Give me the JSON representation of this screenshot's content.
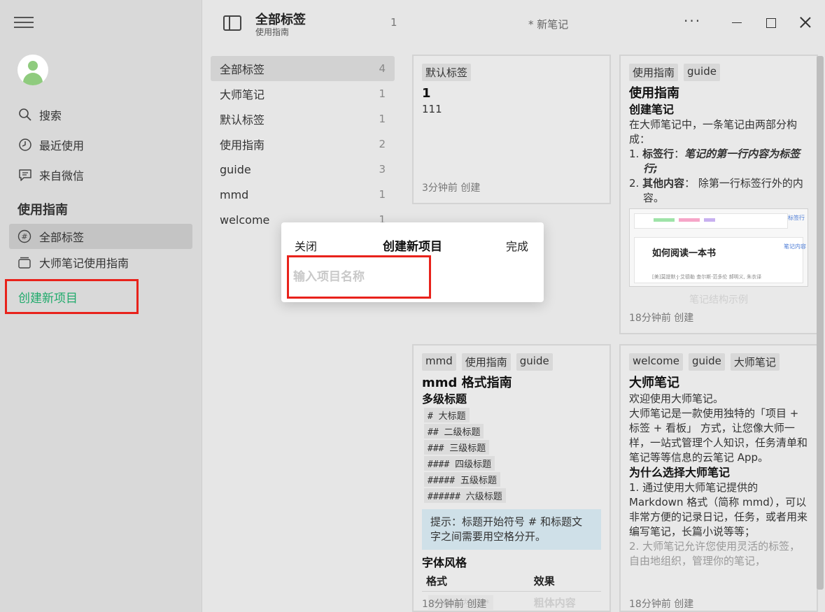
{
  "sidebar": {
    "menu_icon": "hamburger-icon",
    "nav": [
      {
        "label": "搜索",
        "icon": "search-icon"
      },
      {
        "label": "最近使用",
        "icon": "clock-icon"
      },
      {
        "label": "来自微信",
        "icon": "chat-icon"
      }
    ],
    "section_title": "使用指南",
    "projects": [
      {
        "label": "全部标签",
        "icon": "hash-icon",
        "active": true
      },
      {
        "label": "大师笔记使用指南",
        "icon": "stack-icon",
        "active": false
      }
    ],
    "create_label": "创建新项目"
  },
  "topbar": {
    "title": "全部标签",
    "subtitle": "使用指南",
    "count": "1",
    "new_note": "* 新笔记",
    "more": "···"
  },
  "taglist": [
    {
      "label": "全部标签",
      "count": "4"
    },
    {
      "label": "大师笔记",
      "count": "1"
    },
    {
      "label": "默认标签",
      "count": "1"
    },
    {
      "label": "使用指南",
      "count": "2"
    },
    {
      "label": "guide",
      "count": "3"
    },
    {
      "label": "mmd",
      "count": "1"
    },
    {
      "label": "welcome",
      "count": "1"
    }
  ],
  "cards": {
    "c1": {
      "tags": [
        "默认标签"
      ],
      "title": "1",
      "body": "111",
      "meta": "3分钟前 创建"
    },
    "c2": {
      "tags": [
        "使用指南",
        "guide"
      ],
      "title": "使用指南",
      "h2": "创建笔记",
      "intro": "在大师笔记中，一条笔记由两部分构成：",
      "li1_prefix": "1. ",
      "li1_strong": "标签行",
      "li1_sep": "：",
      "li1_em": "笔记的第一行内容为标签行;",
      "li2_prefix": "2. ",
      "li2_strong": "其他内容",
      "li2_rest": "： 除第一行标签行外的内容。",
      "thumb_tag_label": "标签行",
      "thumb_content_label": "笔记内容",
      "thumb_book": "如何阅读一本书",
      "thumb_authors": "[美]莫提默·J·艾德勒 查尔斯·范多伦 郝明义, 朱衣译",
      "caption": "笔记结构示例",
      "meta": "18分钟前 创建"
    },
    "c3": {
      "tags": [
        "mmd",
        "使用指南",
        "guide"
      ],
      "title": "mmd 格式指南",
      "h2": "多级标题",
      "codes": [
        "# 大标题",
        "## 二级标题",
        "### 三级标题",
        "#### 四级标题",
        "##### 五级标题",
        "###### 六级标题"
      ],
      "tip": "提示：标题开始符号 # 和标题文字之间需要用空格分开。",
      "h2b": "字体风格",
      "th1": "格式",
      "th2": "效果",
      "row_code": "**粗体内容**",
      "row_effect": "粗体内容",
      "meta": "18分钟前 创建"
    },
    "c4": {
      "tags": [
        "welcome",
        "guide",
        "大师笔记"
      ],
      "title": "大师笔记",
      "p1": "欢迎使用大师笔记。",
      "p2": "大师笔记是一款使用独特的「项目 + 标签 + 看板」 方式，让您像大师一样，一站式管理个人知识，任务清单和笔记等等信息的云笔记 App。",
      "h2": "为什么选择大师笔记",
      "p3": "1. 通过使用大师笔记提供的 Markdown 格式（简称 mmd），可以非常方便的记录日记，任务，或者用来编写笔记，长篇小说等等；",
      "p4": "2. 大师笔记允许您使用灵活的标签，自由地组织，管理你的笔记，",
      "meta": "18分钟前 创建"
    }
  },
  "modal": {
    "close": "关闭",
    "title": "创建新项目",
    "done": "完成",
    "placeholder": "输入项目名称",
    "value": ""
  },
  "colors": {
    "accent_green": "#1faa6b",
    "highlight_red": "#e8221b"
  }
}
